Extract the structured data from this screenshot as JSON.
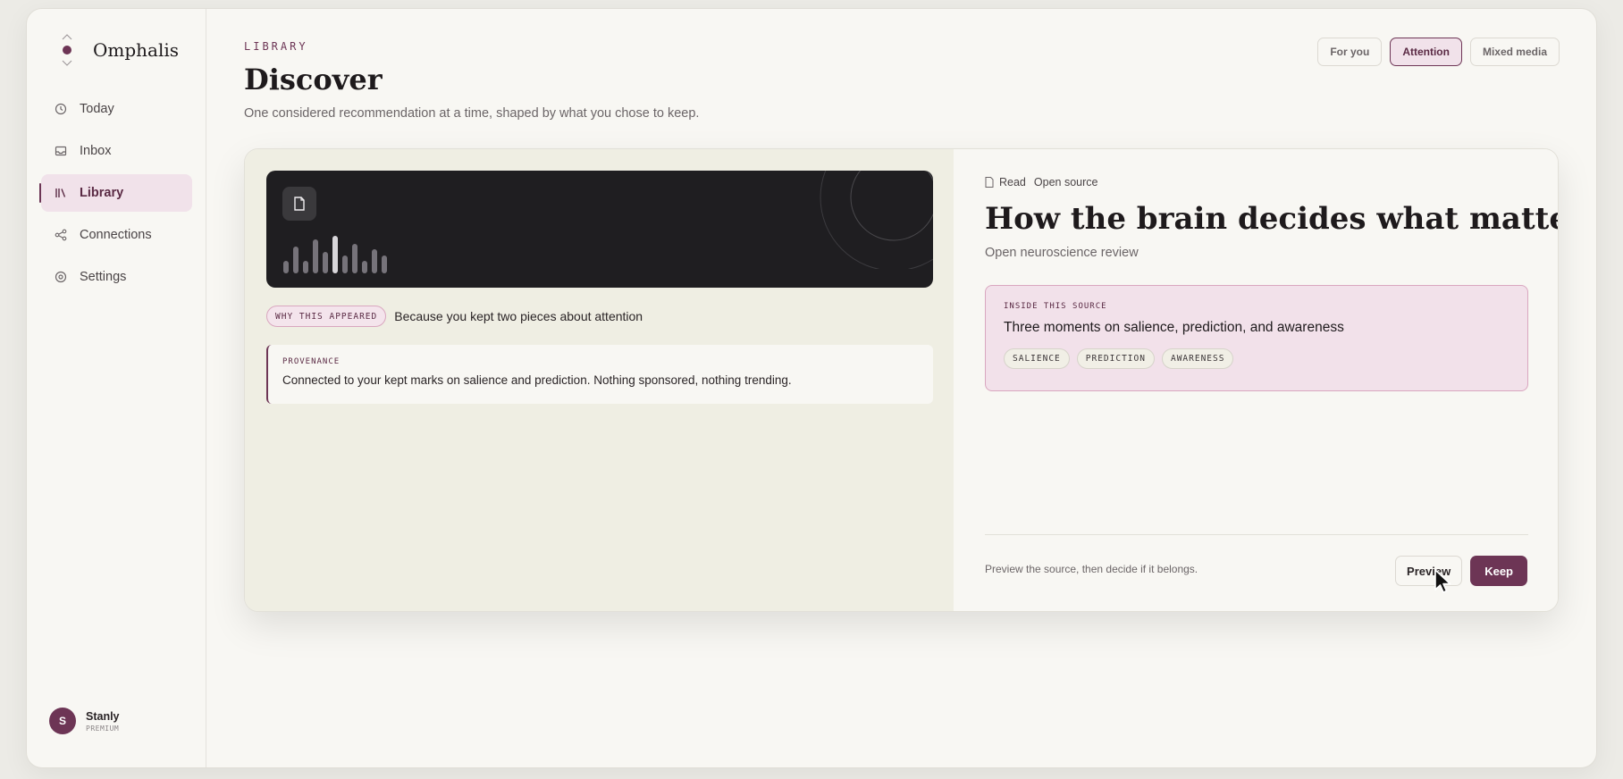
{
  "brand": {
    "name": "Omphalis"
  },
  "sidebar": {
    "items": [
      {
        "label": "Today",
        "icon": "clock-icon",
        "active": false
      },
      {
        "label": "Inbox",
        "icon": "inbox-icon",
        "active": false
      },
      {
        "label": "Library",
        "icon": "library-icon",
        "active": true
      },
      {
        "label": "Connections",
        "icon": "connections-icon",
        "active": false
      },
      {
        "label": "Settings",
        "icon": "settings-icon",
        "active": false
      }
    ]
  },
  "user": {
    "initial": "S",
    "name": "Stanly",
    "plan": "PREMIUM"
  },
  "header": {
    "eyebrow": "LIBRARY",
    "title": "Discover",
    "subtitle": "One considered recommendation at a time, shaped by what you chose to keep."
  },
  "filters": [
    {
      "label": "For you",
      "active": false
    },
    {
      "label": "Attention",
      "active": true
    },
    {
      "label": "Mixed media",
      "active": false
    }
  ],
  "card": {
    "why_label": "WHY THIS APPEARED",
    "why_text": "Because you kept two pieces about attention",
    "provenance_label": "PROVENANCE",
    "provenance_text": "Connected to your kept marks on salience and prediction. Nothing sponsored, nothing trending.",
    "meta_type": "Read",
    "meta_link": "Open source",
    "title": "How the brain decides what matters",
    "subtitle": "Open neuroscience review",
    "inside_label": "INSIDE THIS SOURCE",
    "inside_title": "Three moments on salience, prediction, and awareness",
    "tags": [
      "SALIENCE",
      "PREDICTION",
      "AWARENESS"
    ],
    "footer_note": "Preview the source, then decide if it belongs.",
    "preview_label": "Preview",
    "keep_label": "Keep"
  },
  "colors": {
    "accent": "#6d3555",
    "accent_soft": "#f1e2ea"
  }
}
